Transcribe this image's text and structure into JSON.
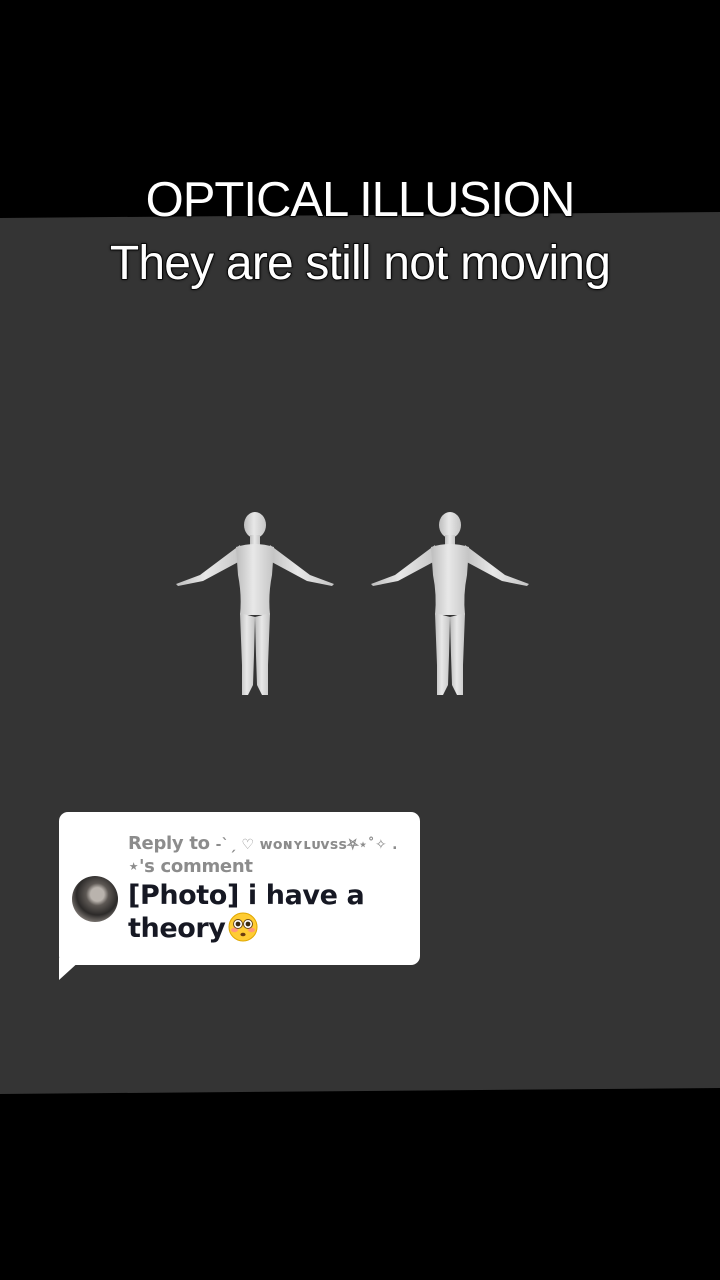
{
  "overlay": {
    "title": "OPTICAL ILLUSION",
    "subtitle": "They are still not moving"
  },
  "reply": {
    "prefix": "Reply to ",
    "username": "-ˋˏ ♡ ᴡᴏɴʏʟᴜᴠꜱꜱ⛧⋆˚✧ .",
    "suffix": "⋆'s comment",
    "body_text": "[Photo] i have a theory",
    "body_emoji": "flushed-face-icon"
  },
  "colors": {
    "background_outer": "#000000",
    "stage": "#343434",
    "figure": "#dedede",
    "card": "#ffffff",
    "header_text": "#8c8c8c",
    "body_text": "#161823"
  }
}
